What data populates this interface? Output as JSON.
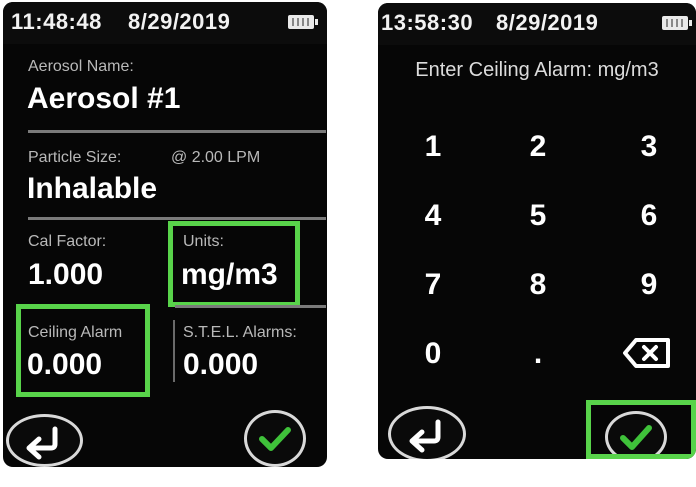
{
  "left_screen": {
    "status": {
      "time": "11:48:48",
      "date": "8/29/2019"
    },
    "aerosol_name": {
      "label": "Aerosol Name:",
      "value": "Aerosol #1"
    },
    "particle_size": {
      "label": "Particle Size:",
      "flow": "@ 2.00 LPM",
      "value": "Inhalable"
    },
    "cal_factor": {
      "label": "Cal Factor:",
      "value": "1.000"
    },
    "units": {
      "label": "Units:",
      "value": "mg/m3"
    },
    "ceiling_alarm": {
      "label": "Ceiling Alarm",
      "value": "0.000"
    },
    "stel_alarms": {
      "label": "S.T.E.L. Alarms:",
      "value": "0.000"
    }
  },
  "right_screen": {
    "status": {
      "time": "13:58:30",
      "date": "8/29/2019"
    },
    "prompt": "Enter Ceiling Alarm: mg/m3",
    "keys": [
      "1",
      "2",
      "3",
      "4",
      "5",
      "6",
      "7",
      "8",
      "9",
      "0",
      "."
    ]
  },
  "icons": {
    "battery": "battery-icon",
    "back": "return-arrow-icon",
    "confirm": "checkmark-icon",
    "backspace": "backspace-icon"
  },
  "colors": {
    "highlight": "#58d34a",
    "check": "#3fc23a",
    "screen_bg": "#060606"
  }
}
